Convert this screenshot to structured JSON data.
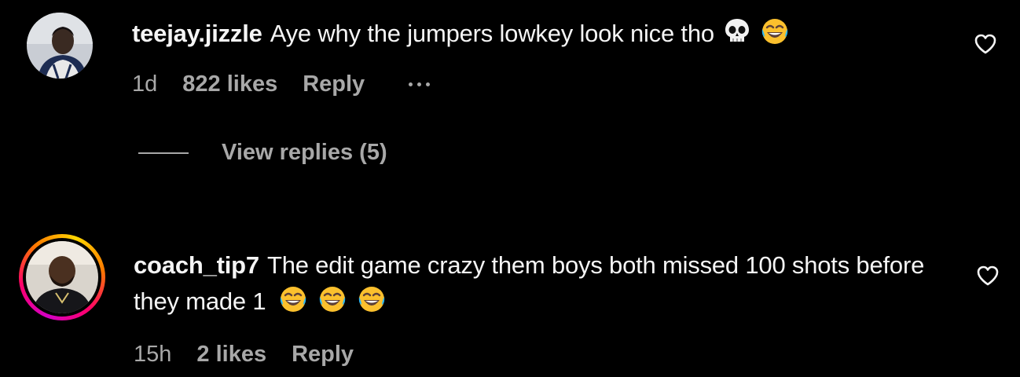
{
  "comments": [
    {
      "username": "teejay.jizzle",
      "text": "Aye why the jumpers lowkey look nice tho",
      "emojis": [
        "skull-emoji",
        "tears-of-joy-emoji"
      ],
      "time": "1d",
      "likes": "822 likes",
      "reply_label": "Reply",
      "view_replies_label": "View replies (5)"
    },
    {
      "username": "coach_tip7",
      "text": "The edit game crazy them boys both missed 100 shots before they made 1",
      "emojis": [
        "tears-of-joy-emoji",
        "tears-of-joy-emoji",
        "tears-of-joy-emoji"
      ],
      "time": "15h",
      "likes": "2 likes",
      "reply_label": "Reply"
    }
  ],
  "icons": {
    "like": "heart-outline-icon",
    "more": "more-options-icon"
  },
  "colors": {
    "background": "#000000",
    "primary_text": "#f5f5f5",
    "secondary_text": "#a8a8a8",
    "story_ring_start": "#d300c5",
    "story_ring_end": "#ffd600"
  }
}
